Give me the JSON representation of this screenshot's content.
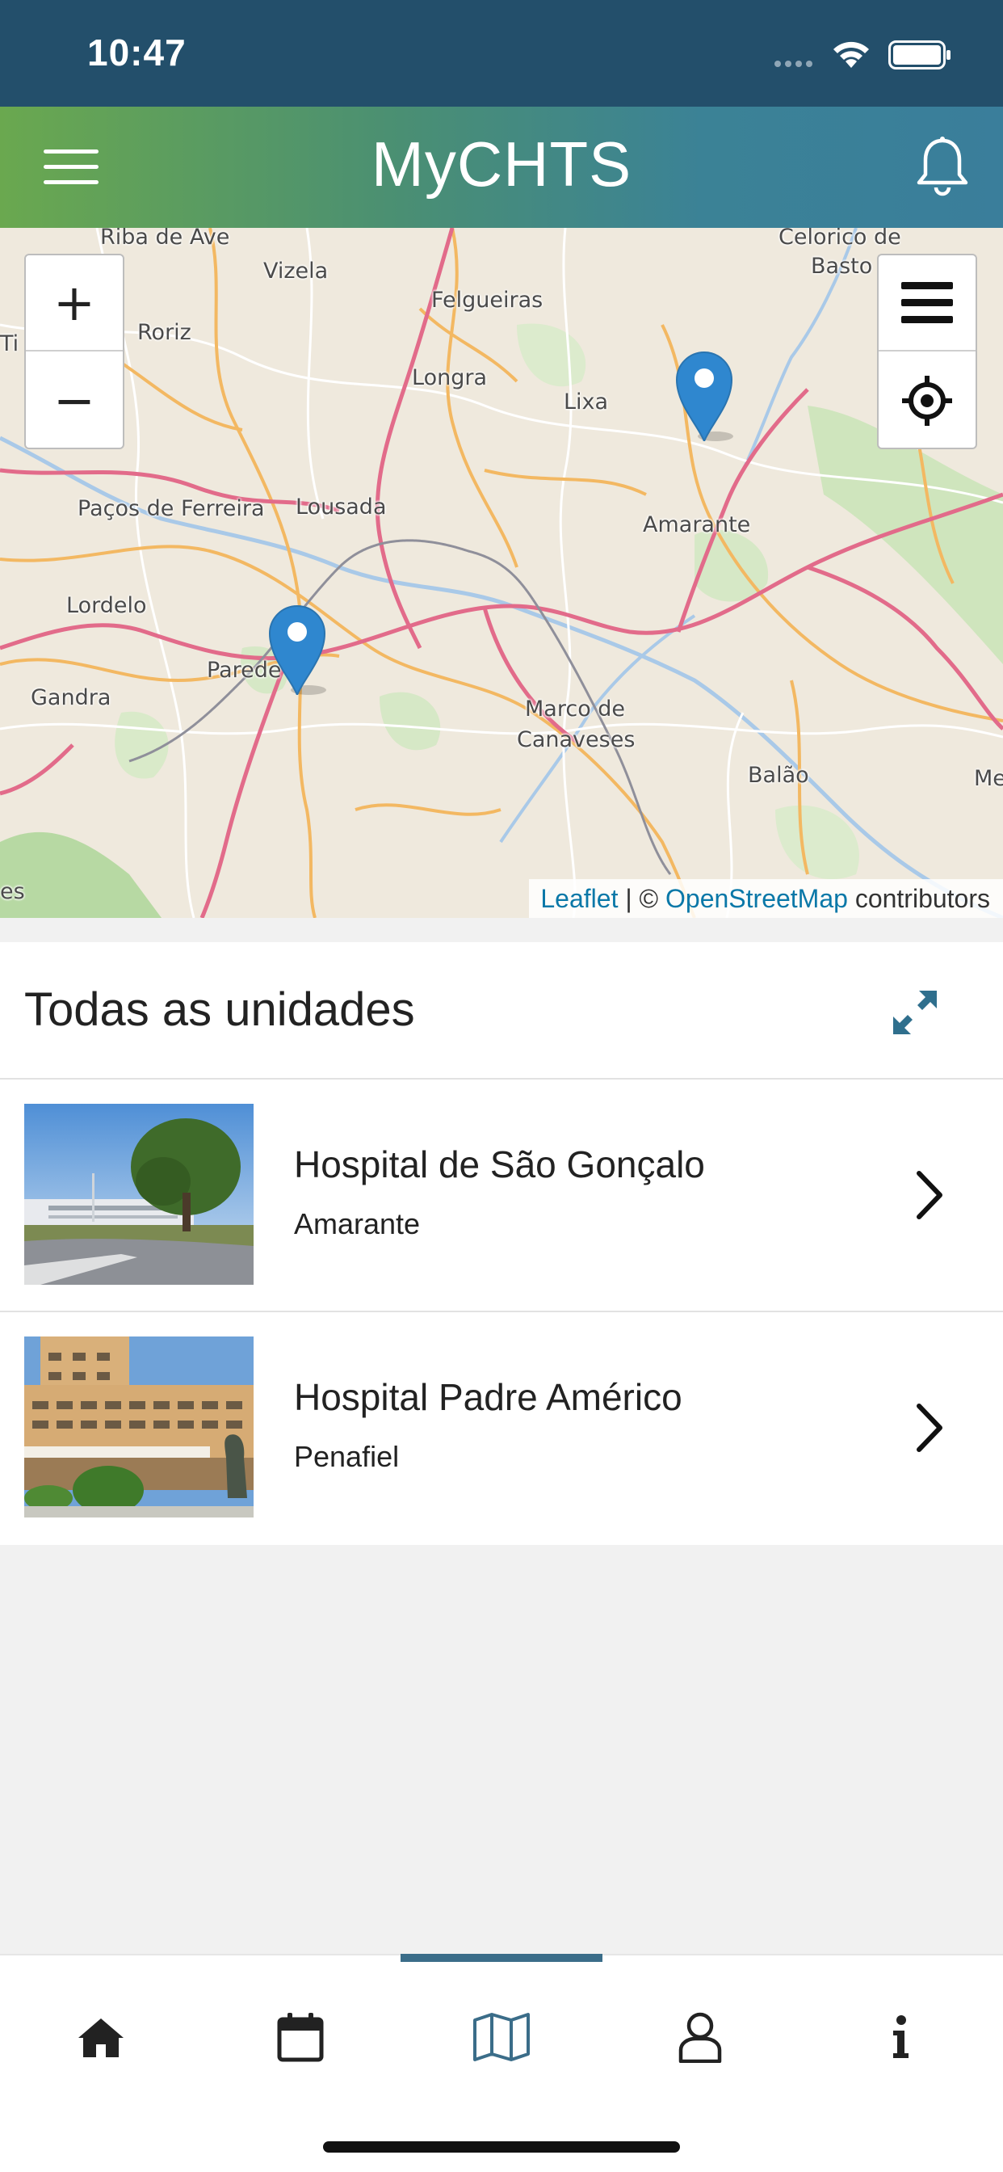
{
  "status": {
    "time": "10:47"
  },
  "header": {
    "title": "MyCHTS"
  },
  "map": {
    "labels": [
      {
        "text": "Riba de Ave"
      },
      {
        "text": "Vizela"
      },
      {
        "text": "Felgueiras"
      },
      {
        "text": "Celorico de"
      },
      {
        "text": "Basto"
      },
      {
        "text": "Roriz"
      },
      {
        "text": "Longra"
      },
      {
        "text": "Lixa"
      },
      {
        "text": "Amarante"
      },
      {
        "text": "Paços de Ferreira"
      },
      {
        "text": "Lousada"
      },
      {
        "text": "Lordelo"
      },
      {
        "text": "Parede"
      },
      {
        "text": "Gandra"
      },
      {
        "text": "Marco de"
      },
      {
        "text": "Canaveses"
      },
      {
        "text": "Balão"
      },
      {
        "text": "Me"
      },
      {
        "text": "Ti"
      },
      {
        "text": "es"
      }
    ],
    "zoom_in": "+",
    "zoom_out": "−",
    "attribution": {
      "leaflet": "Leaflet",
      "sep": " | © ",
      "osm": "OpenStreetMap",
      "suffix": " contributors"
    }
  },
  "units": {
    "title": "Todas as unidades",
    "items": [
      {
        "name": "Hospital de São Gonçalo",
        "city": "Amarante"
      },
      {
        "name": "Hospital Padre Américo",
        "city": "Penafiel"
      }
    ]
  },
  "tabs": [
    {
      "icon": "home-icon"
    },
    {
      "icon": "calendar-icon"
    },
    {
      "icon": "map-icon",
      "active": true
    },
    {
      "icon": "user-icon"
    },
    {
      "icon": "info-icon"
    }
  ],
  "colors": {
    "header_start": "#6aa84f",
    "header_end": "#3a7e9b",
    "status_bar": "#234f6b",
    "accent": "#3b6d89",
    "link": "#0a78a8"
  }
}
